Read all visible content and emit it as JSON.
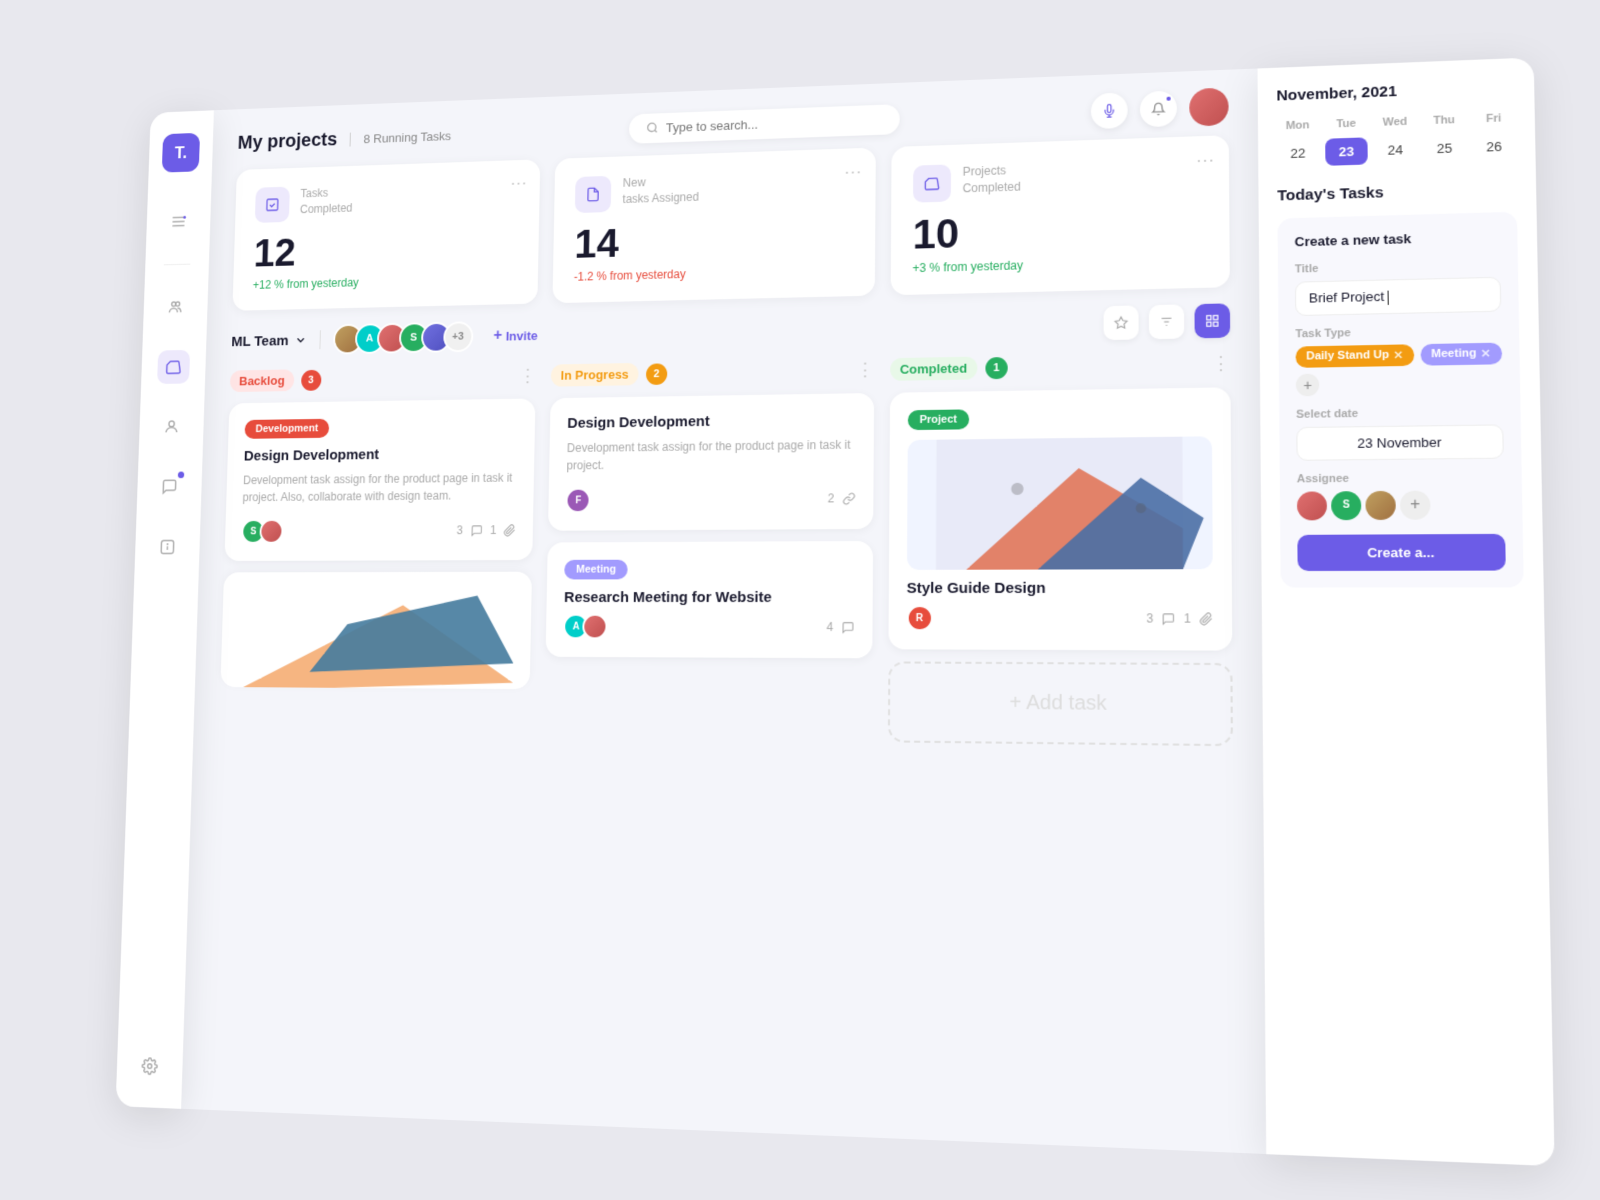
{
  "app": {
    "logo": "T.",
    "search_placeholder": "Type to search..."
  },
  "topbar": {
    "title": "My projects",
    "running_tasks": "8 Running Tasks"
  },
  "stats": [
    {
      "icon": "chart-icon",
      "label1": "Tasks",
      "label2": "Completed",
      "value": "12",
      "change": "+12 % from yesterday",
      "change_type": "positive"
    },
    {
      "icon": "file-icon",
      "label1": "New",
      "label2": "tasks Assigned",
      "value": "14",
      "change": "-1.2 % from yesterday",
      "change_type": "negative"
    },
    {
      "icon": "folder-icon",
      "label1": "Projects",
      "label2": "Completed",
      "value": "10",
      "change": "+3 % from yesterday",
      "change_type": "positive"
    }
  ],
  "team": {
    "name": "ML Team",
    "extra_count": "+3",
    "invite_label": "Invite"
  },
  "kanban": {
    "columns": [
      {
        "title": "Backlog",
        "count": "3",
        "badge_class": "badge-backlog",
        "count_class": "count-backlog"
      },
      {
        "title": "In Progress",
        "count": "2",
        "badge_class": "badge-inprogress",
        "count_class": "count-inprogress"
      },
      {
        "title": "Completed",
        "count": "1",
        "badge_class": "badge-completed",
        "count_class": "count-completed"
      }
    ],
    "cards": {
      "backlog": [
        {
          "tag": "Development",
          "tag_class": "tag-development",
          "title": "Design Development",
          "desc": "Development task assign for the product page in task it project. Also, collaborate with design team.",
          "comments": "3",
          "attachments": "1"
        }
      ],
      "inprogress": [
        {
          "tag": null,
          "title": "Design Development",
          "desc": "Development task assign for the product page in task it project.",
          "comments": "2",
          "avatar_label": "F"
        },
        {
          "tag": "Meeting",
          "tag_class": "tag-meeting",
          "title": "Research Meeting for Website",
          "desc": null,
          "comments": "4"
        }
      ],
      "completed": [
        {
          "tag": "Project",
          "tag_class": "tag-project",
          "title": "Style Guide Design",
          "comments": "3",
          "attachments": "1"
        }
      ]
    }
  },
  "calendar": {
    "month": "November, 2021",
    "days_header": [
      "Mon",
      "Tue",
      "Wed",
      "Thu",
      "Fri"
    ],
    "days": [
      "22",
      "23",
      "24",
      "25",
      "26"
    ],
    "today": "23"
  },
  "today_tasks": {
    "title": "Today's Tasks"
  },
  "create_task": {
    "title": "Create a new task",
    "title_label": "Title",
    "title_value": "Brief Project",
    "task_type_label": "Task Type",
    "tags": [
      "Daily Stand Up",
      "Meeting"
    ],
    "select_date_label": "Select date",
    "date_value": "23 November",
    "assignee_label": "Assignee",
    "create_button": "Create a..."
  },
  "sidebar": {
    "items": [
      {
        "name": "logo",
        "label": "T."
      },
      {
        "name": "notes",
        "label": "≡"
      },
      {
        "name": "divider"
      },
      {
        "name": "team",
        "label": "⊙"
      },
      {
        "name": "projects",
        "label": "▬",
        "active": true
      },
      {
        "name": "users",
        "label": "👤"
      },
      {
        "name": "chat",
        "label": "💬",
        "has_dot": true
      },
      {
        "name": "info",
        "label": "ℹ"
      },
      {
        "name": "settings",
        "label": "⚙"
      }
    ]
  }
}
